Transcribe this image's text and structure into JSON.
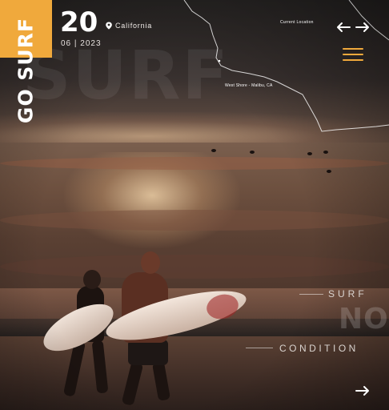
{
  "brand": {
    "part1": "GO",
    "part2": "SURF",
    "accent_color": "#f0a93c"
  },
  "date": {
    "day": "20",
    "month_year": "06 | 2023"
  },
  "location": {
    "icon": "map-pin-icon",
    "name": "California"
  },
  "map": {
    "current_location_label": "Current Location",
    "spot_label": "West Shore - Malibu, CA"
  },
  "nav": {
    "prev_icon": "arrow-left-icon",
    "next_icon": "arrow-right-icon",
    "menu_icon": "hamburger-menu-icon"
  },
  "hero": {
    "background_word": "SURF"
  },
  "conditions": {
    "label_top": "SURF",
    "label_big": "NOW",
    "label_bottom": "CONDITION"
  },
  "footer": {
    "next_icon": "arrow-right-icon"
  }
}
